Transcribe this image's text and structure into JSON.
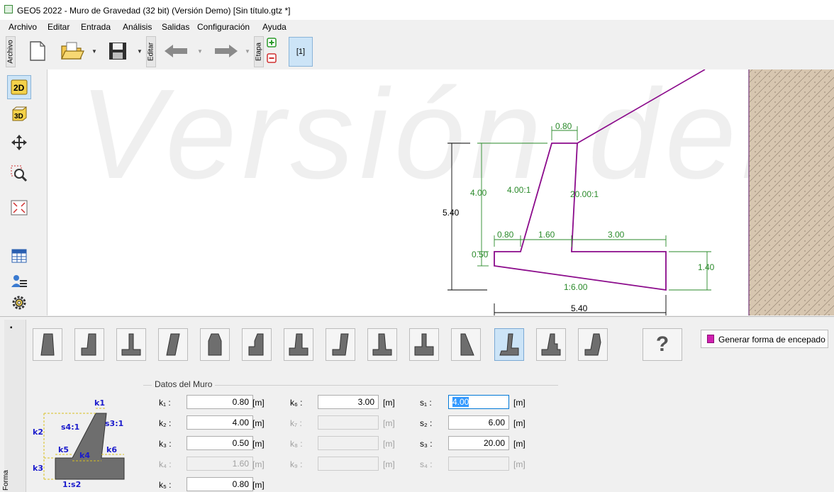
{
  "window": {
    "title": "GEO5 2022 - Muro de Gravedad (32 bit) (Versión Demo) [Sin título.gtz *]"
  },
  "menu": [
    "Archivo",
    "Editar",
    "Entrada",
    "Análisis",
    "Salidas",
    "Configuración",
    "Ayuda"
  ],
  "toolbar": {
    "archivo_label": "Archivo",
    "editar_label": "Editar",
    "etapa_label": "Etapa",
    "stage_label": "[1]"
  },
  "canvas": {
    "watermark": "Versión demo",
    "dims": {
      "top_width": "0.80",
      "front_height": "4.00",
      "total_height": "5.40",
      "front_slope": "4.00:1",
      "back_slope": "20.00:1",
      "toe": "0.80",
      "stem_base": "1.60",
      "heel": "3.00",
      "toe_height": "0.50",
      "heel_height": "1.40",
      "base_slope": "1:6.00",
      "total_width": "5.40"
    }
  },
  "colors": {
    "wall": "#8b0a8b",
    "dimension": "#2a8a2a",
    "selection": "#cce4f7"
  },
  "shapes": {
    "count": 14,
    "selected_index": 11,
    "help_label": "?",
    "generate_label": "Generar forma de encepado"
  },
  "form": {
    "group_title": "Datos del Muro",
    "fields": [
      {
        "label": "k₁ :",
        "value": "0.80",
        "unit": "[m]",
        "enabled": true
      },
      {
        "label": "k₂ :",
        "value": "4.00",
        "unit": "[m]",
        "enabled": true
      },
      {
        "label": "k₃ :",
        "value": "0.50",
        "unit": "[m]",
        "enabled": true
      },
      {
        "label": "k₄ :",
        "value": "1.60",
        "unit": "[m]",
        "enabled": false
      },
      {
        "label": "k₅ :",
        "value": "0.80",
        "unit": "[m]",
        "enabled": true
      },
      {
        "label": "k₆ :",
        "value": "3.00",
        "unit": "[m]",
        "enabled": true
      },
      {
        "label": "k₇ :",
        "value": "",
        "unit": "[m]",
        "enabled": false
      },
      {
        "label": "k₈ :",
        "value": "",
        "unit": "[m]",
        "enabled": false
      },
      {
        "label": "k₉ :",
        "value": "",
        "unit": "[m]",
        "enabled": false
      },
      {
        "label": "s₁ :",
        "value": "4.00",
        "unit": "[m]",
        "enabled": true,
        "focused": true
      },
      {
        "label": "s₂ :",
        "value": "6.00",
        "unit": "[m]",
        "enabled": true
      },
      {
        "label": "s₃ :",
        "value": "20.00",
        "unit": "[m]",
        "enabled": true
      },
      {
        "label": "s₄ :",
        "value": "",
        "unit": "[m]",
        "enabled": false
      }
    ]
  },
  "schematic": {
    "labels": [
      "k1",
      "k2",
      "k3",
      "k4",
      "k5",
      "k6",
      "s4:1",
      "s3:1",
      "1:s2"
    ]
  },
  "side_tab": "Forma"
}
